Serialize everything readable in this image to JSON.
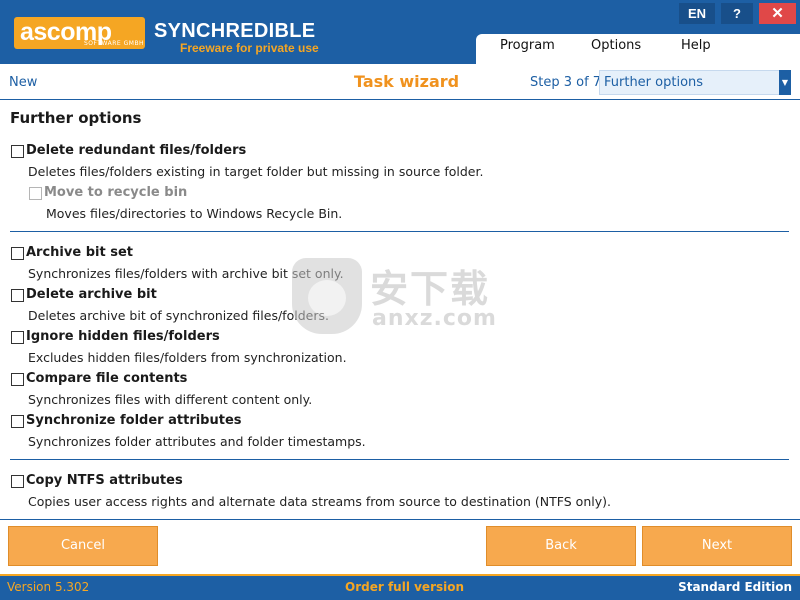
{
  "titlebar": {
    "logo_text": "ascomp",
    "logo_sub": "SOFTWARE GMBH",
    "app_name": "SYNCHREDIBLE",
    "app_sub": "Freeware for private use",
    "lang_button": "EN",
    "help_button": "?",
    "close_button": "✕"
  },
  "menu": {
    "items": [
      "Program",
      "Options",
      "Help"
    ]
  },
  "wizard": {
    "new_label": "New",
    "title": "Task wizard",
    "step_label": "Step 3 of 7:",
    "step_value": "Further options"
  },
  "content": {
    "section_title": "Further options",
    "options": [
      {
        "label": "Delete redundant files/folders",
        "desc": "Deletes files/folders existing in target folder but missing in source folder.",
        "checked": false
      },
      {
        "label": "Move to recycle bin",
        "desc": "Moves files/directories to Windows Recycle Bin.",
        "checked": false,
        "disabled": true
      },
      {
        "label": "Archive bit set",
        "desc": "Synchronizes files/folders with archive bit set only.",
        "checked": false
      },
      {
        "label": "Delete archive bit",
        "desc": "Deletes archive bit of synchronized files/folders.",
        "checked": false
      },
      {
        "label": "Ignore hidden files/folders",
        "desc": "Excludes hidden files/folders from synchronization.",
        "checked": false
      },
      {
        "label": "Compare file contents",
        "desc": "Synchronizes files with different content only.",
        "checked": false
      },
      {
        "label": "Synchronize folder attributes",
        "desc": "Synchronizes folder attributes and folder timestamps.",
        "checked": false
      },
      {
        "label": "Copy NTFS attributes",
        "desc": "Copies user access rights and alternate data streams from source to destination (NTFS only).",
        "checked": false
      }
    ]
  },
  "watermark": {
    "cn": "安下载",
    "en": "anxz.com"
  },
  "buttons": {
    "cancel": "Cancel",
    "back": "Back",
    "next": "Next"
  },
  "status": {
    "version": "Version 5.302",
    "order": "Order full version",
    "edition": "Standard Edition"
  },
  "colors": {
    "brand_blue": "#1d5fa4",
    "accent_orange": "#f5a623",
    "button_orange": "#f7a94e"
  }
}
